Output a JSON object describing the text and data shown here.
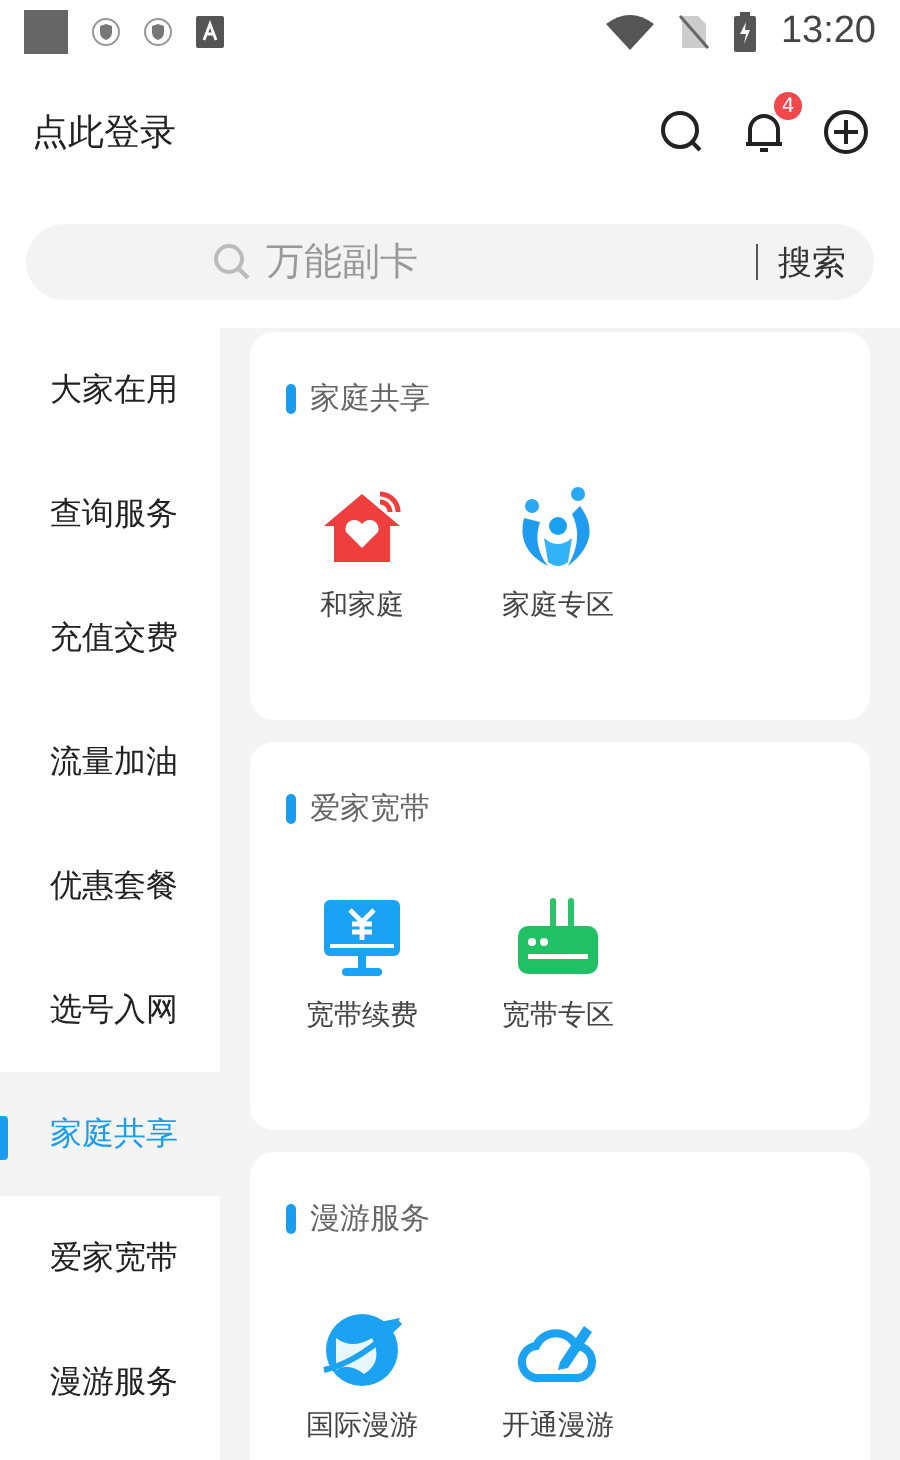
{
  "status_bar": {
    "time": "13:20"
  },
  "header": {
    "login": "点此登录",
    "notification_count": "4"
  },
  "search": {
    "placeholder": "万能副卡",
    "button": "搜索"
  },
  "sidebar": {
    "items": [
      {
        "label": "大家在用",
        "selected": false
      },
      {
        "label": "查询服务",
        "selected": false
      },
      {
        "label": "充值交费",
        "selected": false
      },
      {
        "label": "流量加油",
        "selected": false
      },
      {
        "label": "优惠套餐",
        "selected": false
      },
      {
        "label": "选号入网",
        "selected": false
      },
      {
        "label": "家庭共享",
        "selected": true
      },
      {
        "label": "爱家宽带",
        "selected": false
      },
      {
        "label": "漫游服务",
        "selected": false
      }
    ]
  },
  "sections": [
    {
      "title": "家庭共享",
      "items": [
        {
          "label": "和家庭",
          "kind": "home"
        },
        {
          "label": "家庭专区",
          "kind": "family"
        }
      ]
    },
    {
      "title": "爱家宽带",
      "items": [
        {
          "label": "宽带续费",
          "kind": "monitor"
        },
        {
          "label": "宽带专区",
          "kind": "router"
        }
      ]
    },
    {
      "title": "漫游服务",
      "items": [
        {
          "label": "国际漫游",
          "kind": "globe"
        },
        {
          "label": "开通漫游",
          "kind": "cloud"
        }
      ]
    }
  ]
}
